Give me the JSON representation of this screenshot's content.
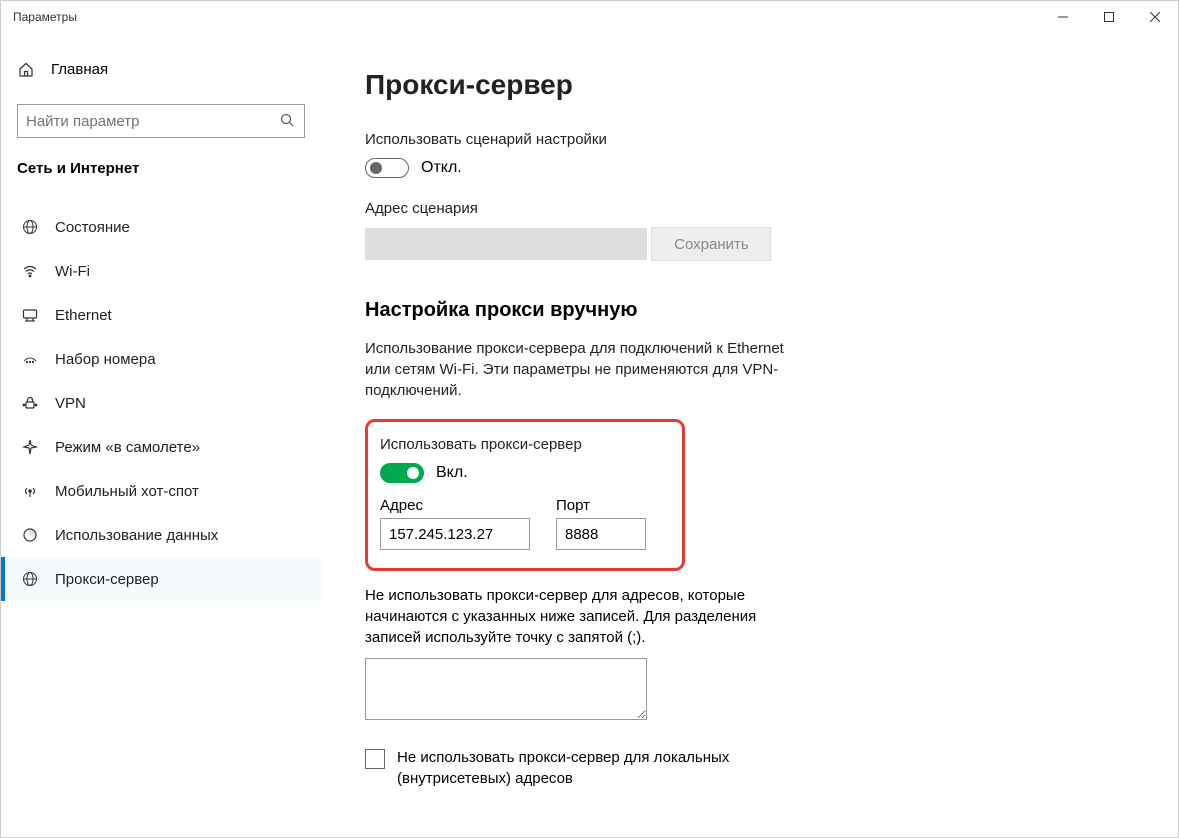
{
  "window": {
    "title": "Параметры"
  },
  "sidebar": {
    "home_label": "Главная",
    "search_placeholder": "Найти параметр",
    "category": "Сеть и Интернет",
    "items": [
      {
        "label": "Состояние"
      },
      {
        "label": "Wi-Fi"
      },
      {
        "label": "Ethernet"
      },
      {
        "label": "Набор номера"
      },
      {
        "label": "VPN"
      },
      {
        "label": "Режим «в самолете»"
      },
      {
        "label": "Мобильный хот-спот"
      },
      {
        "label": "Использование данных"
      },
      {
        "label": "Прокси-сервер"
      }
    ]
  },
  "main": {
    "title": "Прокси-сервер",
    "script": {
      "label": "Использовать сценарий настройки",
      "state": "Откл.",
      "address_label": "Адрес сценария",
      "save_label": "Сохранить"
    },
    "manual": {
      "title": "Настройка прокси вручную",
      "desc": "Использование прокси-сервера для подключений к Ethernet или сетям Wi-Fi. Эти параметры не применяются для VPN-подключений.",
      "use_label": "Использовать прокси-сервер",
      "use_state": "Вкл.",
      "address_label": "Адрес",
      "address_value": "157.245.123.27",
      "port_label": "Порт",
      "port_value": "8888",
      "exclusions_desc": "Не использовать прокси-сервер для адресов, которые начинаются с указанных ниже записей. Для разделения записей используйте точку с запятой (;).",
      "local_label": "Не использовать прокси-сервер для локальных (внутрисетевых) адресов"
    }
  }
}
